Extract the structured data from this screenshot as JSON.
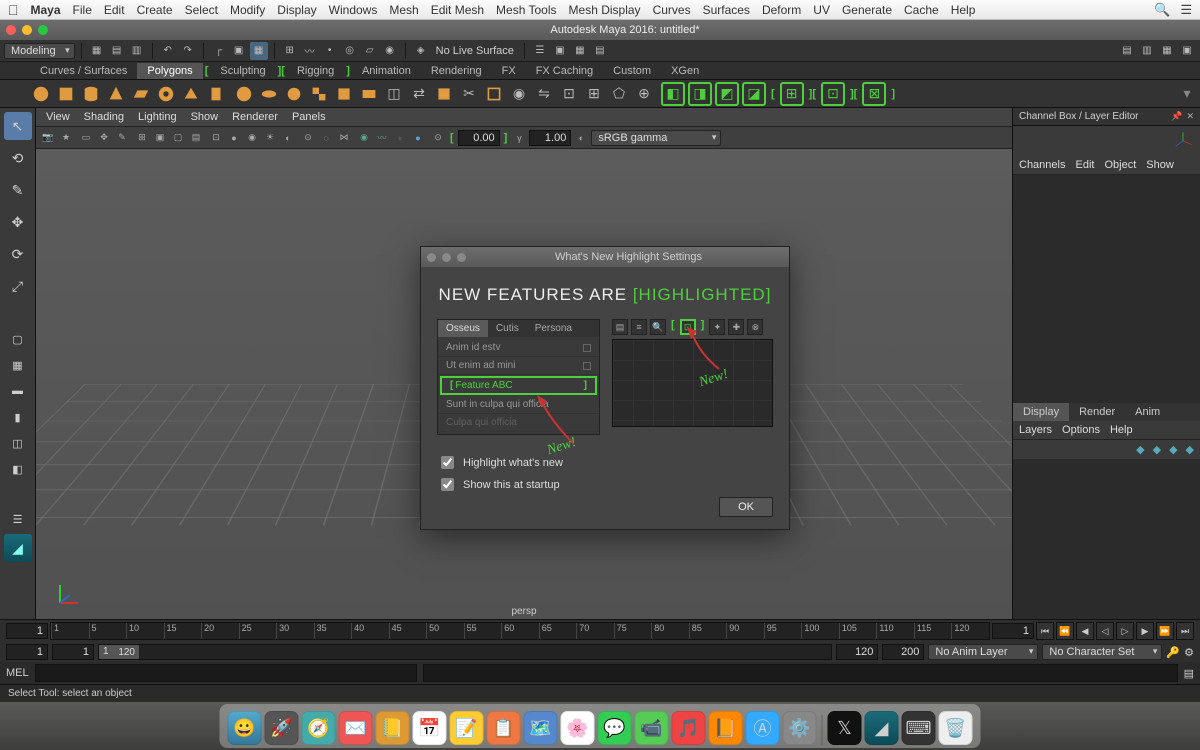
{
  "mac_menu": {
    "app": "Maya",
    "items": [
      "File",
      "Edit",
      "Create",
      "Select",
      "Modify",
      "Display",
      "Windows",
      "Mesh",
      "Edit Mesh",
      "Mesh Tools",
      "Mesh Display",
      "Curves",
      "Surfaces",
      "Deform",
      "UV",
      "Generate",
      "Cache",
      "Help"
    ]
  },
  "window_title": "Autodesk Maya 2016: untitled*",
  "status_line": {
    "menu_set": "Modeling",
    "no_live": "No Live Surface"
  },
  "shelf_tabs": [
    "Curves / Surfaces",
    "Polygons",
    "Sculpting",
    "Rigging",
    "Animation",
    "Rendering",
    "FX",
    "FX Caching",
    "Custom",
    "XGen"
  ],
  "shelf_active_idx": 1,
  "shelf_highlighted": [
    2,
    3
  ],
  "viewport_menus": [
    "View",
    "Shading",
    "Lighting",
    "Show",
    "Renderer",
    "Panels"
  ],
  "vp_toolbar": {
    "val1": "0.00",
    "val2": "1.00",
    "colorspace": "sRGB gamma"
  },
  "persp": "persp",
  "channel_box": {
    "title": "Channel Box / Layer Editor",
    "menus": [
      "Channels",
      "Edit",
      "Object",
      "Show"
    ],
    "tabs": [
      "Display",
      "Render",
      "Anim"
    ],
    "layers_menus": [
      "Layers",
      "Options",
      "Help"
    ]
  },
  "timeline": {
    "ticks": [
      "1",
      "5",
      "10",
      "15",
      "20",
      "25",
      "30",
      "35",
      "40",
      "45",
      "50",
      "55",
      "60",
      "65",
      "70",
      "75",
      "80",
      "85",
      "90",
      "95",
      "100",
      "105",
      "110",
      "115",
      "120"
    ],
    "cur": "1",
    "cur2": "1",
    "range_start": "1",
    "range_end": "120",
    "end1": "120",
    "end2": "200",
    "anim_layer": "No Anim Layer",
    "char_set": "No Character Set"
  },
  "mel": {
    "label": "MEL"
  },
  "help_line": "Select Tool: select an object",
  "dialog": {
    "title": "What's New Highlight Settings",
    "headline_pre": "NEW FEATURES ARE ",
    "headline_hl": "[HIGHLIGHTED]",
    "tabs": [
      "Osseus",
      "Cutis",
      "Persona"
    ],
    "rows": [
      "Anim id estv",
      "Ut enim ad mini",
      "Feature ABC",
      "Sunt in culpa qui officia",
      "Culpa qui officia"
    ],
    "hl_row_idx": 2,
    "new_label": "New!",
    "cb1": "Highlight what's new",
    "cb2": "Show this at startup",
    "ok": "OK"
  }
}
